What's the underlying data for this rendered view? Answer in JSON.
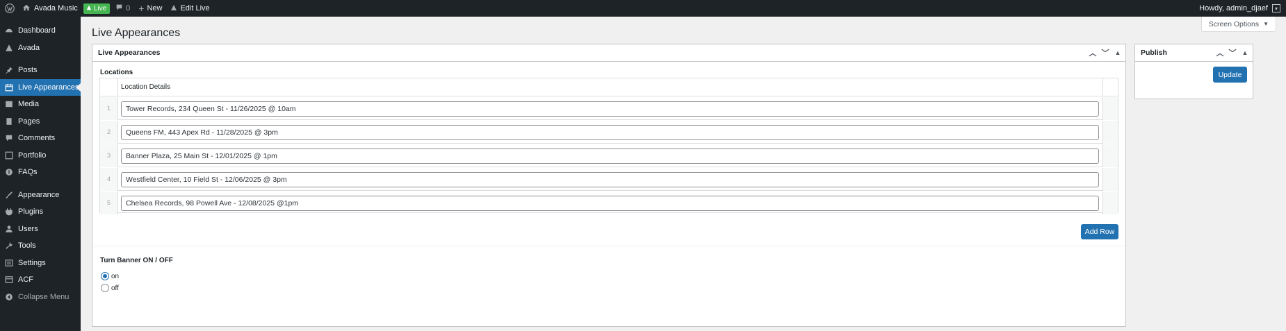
{
  "admin_bar": {
    "site_name": "Avada Music",
    "live_badge": "Live",
    "comments_count": "0",
    "new_label": "New",
    "edit_live_label": "Edit Live",
    "howdy": "Howdy, admin_djaef"
  },
  "sidebar": {
    "items": [
      {
        "label": "Dashboard",
        "icon": "dashboard-icon"
      },
      {
        "label": "Avada",
        "icon": "avada-icon"
      },
      {
        "label": "Posts",
        "icon": "pin-icon"
      },
      {
        "label": "Live Appearances",
        "icon": "calendar-icon",
        "current": true
      },
      {
        "label": "Media",
        "icon": "media-icon"
      },
      {
        "label": "Pages",
        "icon": "pages-icon"
      },
      {
        "label": "Comments",
        "icon": "comments-icon"
      },
      {
        "label": "Portfolio",
        "icon": "portfolio-icon"
      },
      {
        "label": "FAQs",
        "icon": "info-icon"
      },
      {
        "label": "Appearance",
        "icon": "brush-icon"
      },
      {
        "label": "Plugins",
        "icon": "plugin-icon"
      },
      {
        "label": "Users",
        "icon": "users-icon"
      },
      {
        "label": "Tools",
        "icon": "wrench-icon"
      },
      {
        "label": "Settings",
        "icon": "settings-icon"
      },
      {
        "label": "ACF",
        "icon": "acf-icon"
      }
    ],
    "collapse_label": "Collapse Menu"
  },
  "header": {
    "screen_options": "Screen Options",
    "page_title": "Live Appearances"
  },
  "main_box": {
    "title": "Live Appearances",
    "locations_label": "Locations",
    "column_header": "Location Details",
    "rows": [
      {
        "num": "1",
        "value": "Tower Records, 234 Queen St - 11/26/2025 @ 10am"
      },
      {
        "num": "2",
        "value": "Queens FM, 443 Apex Rd - 11/28/2025 @ 3pm"
      },
      {
        "num": "3",
        "value": "Banner Plaza, 25 Main St - 12/01/2025 @ 1pm"
      },
      {
        "num": "4",
        "value": "Westfield Center, 10 Field St - 12/06/2025 @ 3pm"
      },
      {
        "num": "5",
        "value": "Chelsea Records, 98 Powell Ave - 12/08/2025 @1pm"
      }
    ],
    "add_row_label": "Add Row",
    "banner_label": "Turn Banner ON / OFF",
    "radio_options": [
      {
        "label": "on",
        "checked": true
      },
      {
        "label": "off",
        "checked": false
      }
    ]
  },
  "publish_box": {
    "title": "Publish",
    "update_label": "Update"
  },
  "colors": {
    "admin_dark": "#1d2327",
    "accent_blue": "#2271b1",
    "live_green": "#46b450"
  }
}
